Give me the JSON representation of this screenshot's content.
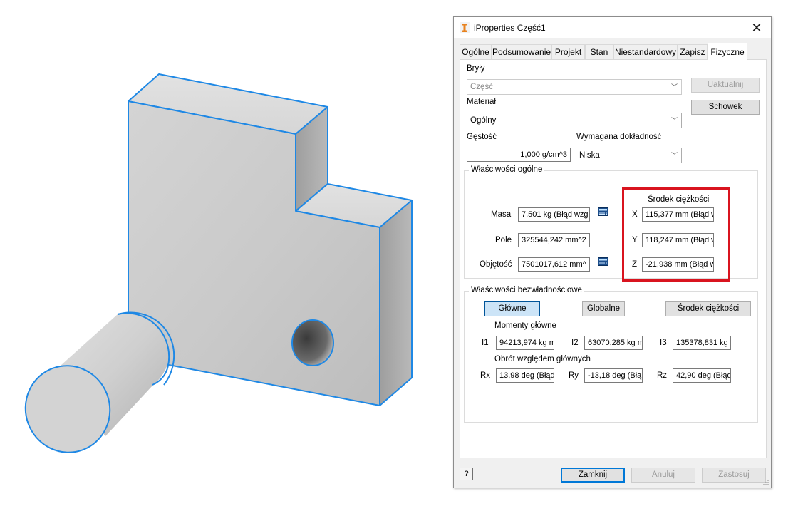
{
  "dialog": {
    "title": "iProperties Część1",
    "close_glyph": "✕",
    "tabs": [
      "Ogólne",
      "Podsumowanie",
      "Projekt",
      "Stan",
      "Niestandardowy",
      "Zapisz",
      "Fizyczne"
    ],
    "active_tab": "Fizyczne"
  },
  "physical": {
    "solids_label": "Bryły",
    "solids_value": "Część",
    "update_button": "Uaktualnij",
    "material_label": "Materiał",
    "material_value": "Ogólny",
    "clipboard_button": "Schowek",
    "density_label": "Gęstość",
    "density_value": "1,000 g/cm^3",
    "accuracy_label": "Wymagana dokładność",
    "accuracy_value": "Niska"
  },
  "general": {
    "group_title": "Właściwości ogólne",
    "mass_label": "Masa",
    "mass_value": "7,501 kg (Błąd wzg",
    "area_label": "Pole",
    "area_value": "325544,242 mm^2",
    "volume_label": "Objętość",
    "volume_value": "7501017,612 mm^",
    "cog_title": "Środek ciężkości",
    "x_label": "X",
    "x_value": "115,377 mm (Błąd w",
    "y_label": "Y",
    "y_value": "118,247 mm (Błąd w",
    "z_label": "Z",
    "z_value": "-21,938 mm (Błąd w"
  },
  "inertial": {
    "group_title": "Właściwości bezwładnościowe",
    "btn_principal": "Główne",
    "btn_global": "Globalne",
    "btn_cog": "Środek ciężkości",
    "moments_label": "Momenty główne",
    "i1_label": "I1",
    "i1_value": "94213,974 kg m",
    "i2_label": "I2",
    "i2_value": "63070,285 kg m",
    "i3_label": "I3",
    "i3_value": "135378,831 kg",
    "rotation_label": "Obrót względem głównych",
    "rx_label": "Rx",
    "rx_value": "13,98 deg (Błąd",
    "ry_label": "Ry",
    "ry_value": "-13,18 deg (Błą",
    "rz_label": "Rz",
    "rz_value": "42,90 deg (Błąd"
  },
  "footer": {
    "help_glyph": "?",
    "close_button": "Zamknij",
    "cancel_button": "Anuluj",
    "apply_button": "Zastosuj"
  },
  "colors": {
    "highlight": "#d9141f",
    "edge_selection": "#1e88e5",
    "model_face": "#c8c8c8"
  }
}
